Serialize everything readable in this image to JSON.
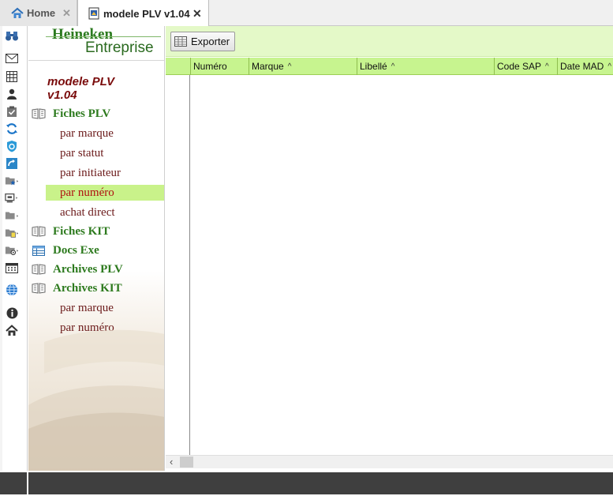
{
  "tabs": [
    {
      "label": "Home",
      "icon": "home-icon"
    },
    {
      "label": "modele PLV  v1.04",
      "icon": "document-icon"
    }
  ],
  "nav": {
    "logo_line1": "Heineken",
    "logo_line2": "Entreprise",
    "module_title": "modele PLV v1.04",
    "sections": [
      {
        "label": "Fiches PLV",
        "subs": [
          "par marque",
          "par statut",
          "par initiateur",
          "par numéro",
          "achat direct"
        ],
        "selected": "par numéro"
      },
      {
        "label": "Fiches KIT",
        "subs": []
      },
      {
        "label": "Docs Exe",
        "subs": []
      },
      {
        "label": "Archives PLV",
        "subs": []
      },
      {
        "label": "Archives KIT",
        "subs": [
          "par marque",
          "par numéro"
        ]
      }
    ]
  },
  "toolbar": {
    "export_label": "Exporter"
  },
  "grid": {
    "columns": [
      {
        "label": "Numéro",
        "sortable": false
      },
      {
        "label": "Marque",
        "sortable": true
      },
      {
        "label": "Libellé",
        "sortable": true
      },
      {
        "label": "Code SAP",
        "sortable": true
      },
      {
        "label": "Date MAD",
        "sortable": true
      }
    ],
    "sort_glyph": "^",
    "rows": []
  },
  "colors": {
    "accent_green": "#2d7a1e",
    "header_green": "#c7f48f",
    "selection_green": "#c9f28a",
    "link_maroon": "#6b1a1a"
  }
}
